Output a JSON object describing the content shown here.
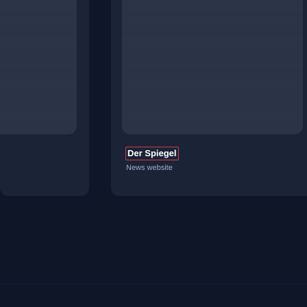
{
  "cards": {
    "featured": {
      "title": "Der Spiegel",
      "subtitle": "News website"
    }
  }
}
